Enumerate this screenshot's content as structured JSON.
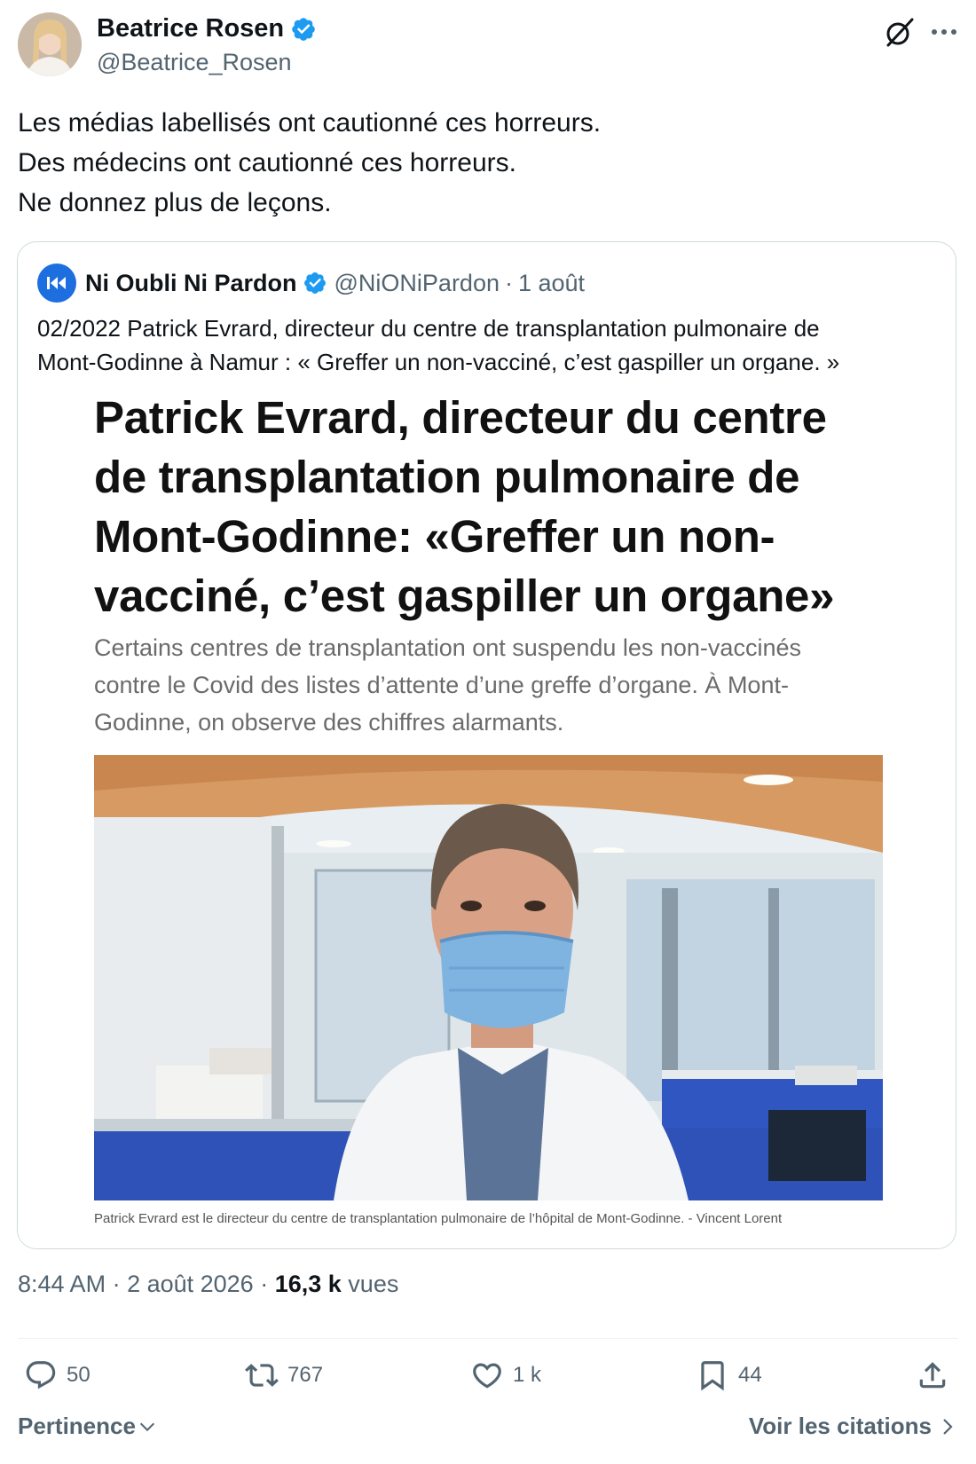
{
  "author": {
    "name": "Beatrice Rosen",
    "handle": "@Beatrice_Rosen"
  },
  "tweet": {
    "lines": [
      "Les médias labellisés ont cautionné ces horreurs.",
      "Des médecins ont cautionné ces horreurs.",
      "Ne donnez plus de leçons."
    ]
  },
  "quote": {
    "name": "Ni Oubli Ni Pardon",
    "handle": "@NiONiPardon",
    "separator": "·",
    "date": "1 août",
    "text_lines": [
      "02/2022 Patrick Evrard, directeur du centre de transplantation pulmonaire de",
      "Mont-Godinne à Namur : « Greffer un non-vacciné, c’est gaspiller un organe. »"
    ],
    "article": {
      "headline_lines": [
        "Patrick Evrard, directeur du centre",
        "de transplantation pulmonaire de",
        "Mont-Godinne: «Greffer un non-",
        "vacciné, c’est gaspiller un organe»"
      ],
      "lede_lines": [
        "Certains centres de transplantation ont suspendu les non-vaccinés",
        "contre le Covid des listes d’attente d’une greffe d’organe. À Mont-",
        "Godinne, on observe des chiffres alarmants."
      ],
      "caption": "Patrick Evrard est le directeur du centre de transplantation pulmonaire de l’hôpital de Mont-Godinne. - Vincent Lorent"
    }
  },
  "meta": {
    "time": "8:44 AM",
    "sep1": " · ",
    "date": "2 août 2026",
    "sep2": " · ",
    "views_count": "16,3 k",
    "views_label": "vues"
  },
  "actions": {
    "replies": "50",
    "reposts": "767",
    "likes": "1 k",
    "bookmarks": "44"
  },
  "footer": {
    "sort_label": "Pertinence",
    "quotes_link": "Voir les citations"
  },
  "colors": {
    "verified": "#1d9bf0",
    "secondary_text": "#536471",
    "quote_avatar_bg": "#1d6fe0"
  },
  "icons": {
    "verified": "verified-badge-icon",
    "grok": "grok-icon",
    "more": "more-icon",
    "reply": "reply-icon",
    "retweet": "retweet-icon",
    "like": "heart-icon",
    "bookmark": "bookmark-icon",
    "share": "share-icon"
  }
}
